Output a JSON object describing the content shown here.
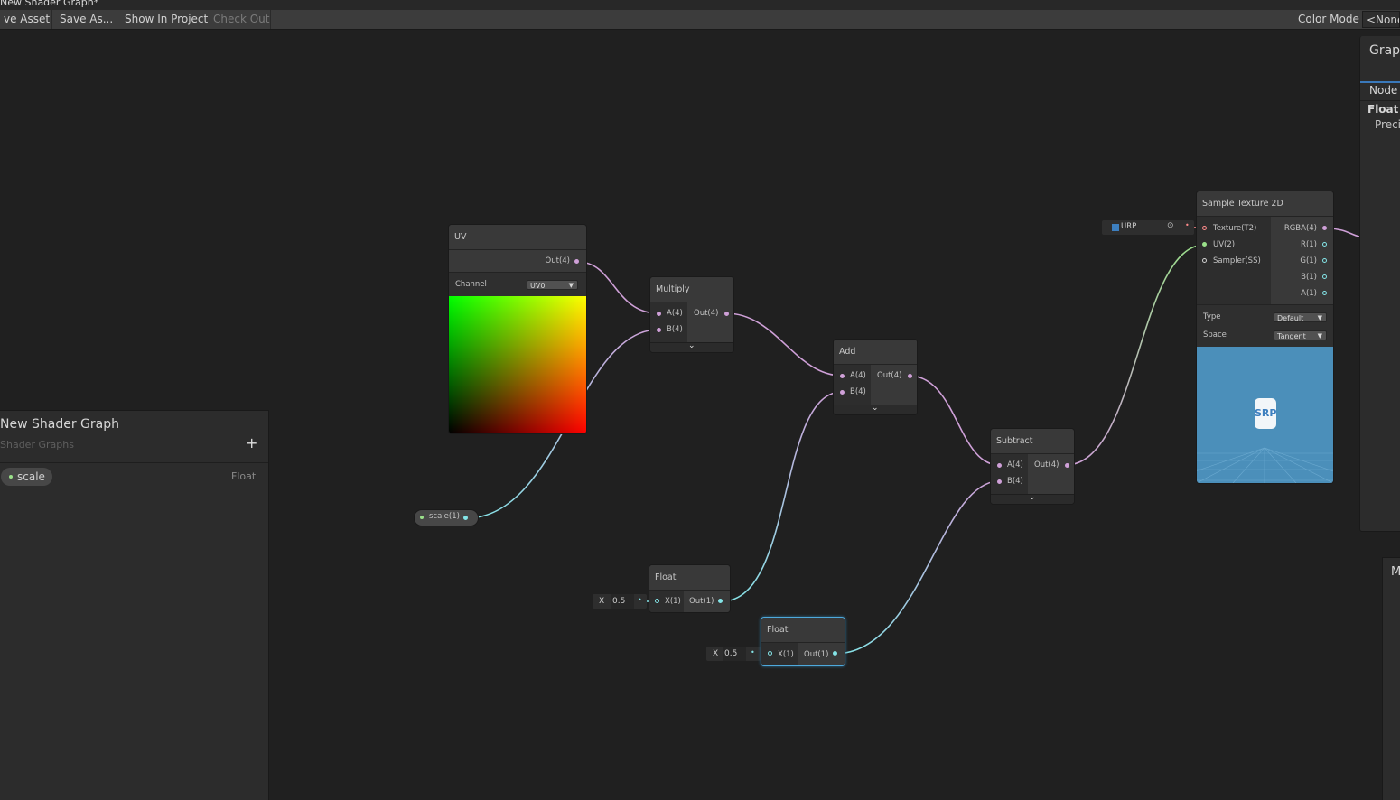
{
  "window": {
    "title": "New Shader Graph*"
  },
  "toolbar": {
    "save_asset": "ve Asset",
    "save_as": "Save As...",
    "show_in_project": "Show In Project",
    "check_out": "Check Out",
    "color_mode_label": "Color Mode",
    "color_mode_value": "<None"
  },
  "blackboard": {
    "title": "New Shader Graph",
    "subtitle": "Shader Graphs",
    "add_symbol": "+",
    "properties": [
      {
        "name": "scale",
        "type": "Float"
      }
    ]
  },
  "graph_inspector": {
    "title": "Grapl",
    "tab_node": "Node",
    "section": "Float N",
    "field": "Preci"
  },
  "m_panel": {
    "title": "M"
  },
  "nodes": {
    "uv": {
      "title": "UV",
      "out": "Out(4)",
      "channel_label": "Channel",
      "channel_value": "UV0"
    },
    "multiply": {
      "title": "Multiply",
      "in_a": "A(4)",
      "in_b": "B(4)",
      "out": "Out(4)"
    },
    "add": {
      "title": "Add",
      "in_a": "A(4)",
      "in_b": "B(4)",
      "out": "Out(4)"
    },
    "subtract": {
      "title": "Subtract",
      "in_a": "A(4)",
      "in_b": "B(4)",
      "out": "Out(4)"
    },
    "float1": {
      "title": "Float",
      "in_x": "X(1)",
      "out": "Out(1)",
      "x_label": "X",
      "x_value": "0.5"
    },
    "float2": {
      "title": "Float",
      "in_x": "X(1)",
      "out": "Out(1)",
      "x_label": "X",
      "x_value": "0.5"
    },
    "scale_prop": {
      "label": "scale(1)"
    },
    "sample_texture": {
      "title": "Sample Texture 2D",
      "texture_field": "URP",
      "in_texture": "Texture(T2)",
      "in_uv": "UV(2)",
      "in_sampler": "Sampler(SS)",
      "outs": [
        "RGBA(4)",
        "R(1)",
        "G(1)",
        "B(1)",
        "A(1)"
      ],
      "type_label": "Type",
      "type_value": "Default",
      "space_label": "Space",
      "space_value": "Tangent",
      "preview_logo": "SRP"
    }
  },
  "colors": {
    "vector4_wire": "#cfa0d8",
    "vector1_wire": "#84e4e7",
    "vector2_wire": "#9ae08a",
    "texture_port": "#ff8b8b",
    "selection": "#4ea9dc",
    "preview_bg": "#4b8fba"
  },
  "icons": {
    "expand": "chevron-down-icon",
    "add": "plus-icon",
    "target": "target-icon"
  }
}
